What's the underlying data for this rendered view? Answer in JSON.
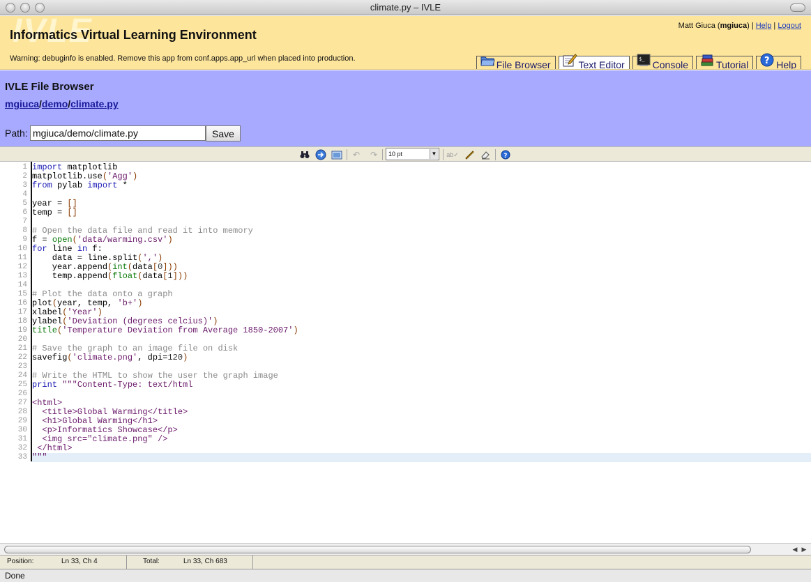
{
  "window": {
    "title": "climate.py – IVLE"
  },
  "header": {
    "watermark": "IVLE",
    "title": "Informatics Virtual Learning Environment",
    "warning": "Warning: debuginfo is enabled. Remove this app from conf.apps.app_url when placed into production.",
    "user_name": "Matt Giuca",
    "user_login": "mgiuca",
    "help_link": "Help",
    "logout_link": "Logout",
    "tabs": [
      {
        "label": "File Browser",
        "icon": "folder-icon"
      },
      {
        "label": "Text Editor",
        "icon": "pencil-notepad-icon"
      },
      {
        "label": "Console",
        "icon": "terminal-icon"
      },
      {
        "label": "Tutorial",
        "icon": "books-icon"
      },
      {
        "label": "Help",
        "icon": "question-icon"
      }
    ]
  },
  "filebrowser": {
    "title": "IVLE File Browser",
    "crumbs": [
      "mgiuca",
      "demo",
      "climate.py"
    ],
    "path_label": "Path:",
    "path_value": "mgiuca/demo/climate.py",
    "save_label": "Save"
  },
  "toolbar": {
    "font_size": "10 pt",
    "icons": [
      "search-binoculars-icon",
      "goto-line-icon",
      "fullscreen-icon",
      "undo-icon",
      "redo-icon",
      "spellcheck-icon",
      "highlight-icon",
      "reset-icon",
      "help-icon"
    ]
  },
  "code_lines": [
    "import matplotlib",
    "matplotlib.use('Agg')",
    "from pylab import *",
    "",
    "year = []",
    "temp = []",
    "",
    "# Open the data file and read it into memory",
    "f = open('data/warming.csv')",
    "for line in f:",
    "    data = line.split(',')",
    "    year.append(int(data[0]))",
    "    temp.append(float(data[1]))",
    "",
    "# Plot the data onto a graph",
    "plot(year, temp, 'b+')",
    "xlabel('Year')",
    "ylabel('Deviation (degrees celcius)')",
    "title('Temperature Deviation from Average 1850-2007')",
    "",
    "# Save the graph to an image file on disk",
    "savefig('climate.png', dpi=120)",
    "",
    "# Write the HTML to show the user the graph image",
    "print \"\"\"Content-Type: text/html",
    "",
    "<html>",
    "  <title>Global Warming</title>",
    "  <h1>Global Warming</h1>",
    "  <p>Informatics Showcase</p>",
    "  <img src=\"climate.png\" />",
    " </html>",
    "\"\"\""
  ],
  "current_line": 33,
  "status": {
    "position_label": "Position:",
    "position_value": "Ln 33, Ch 4",
    "total_label": "Total:",
    "total_value": "Ln 33, Ch 683"
  },
  "browser_status": "Done"
}
